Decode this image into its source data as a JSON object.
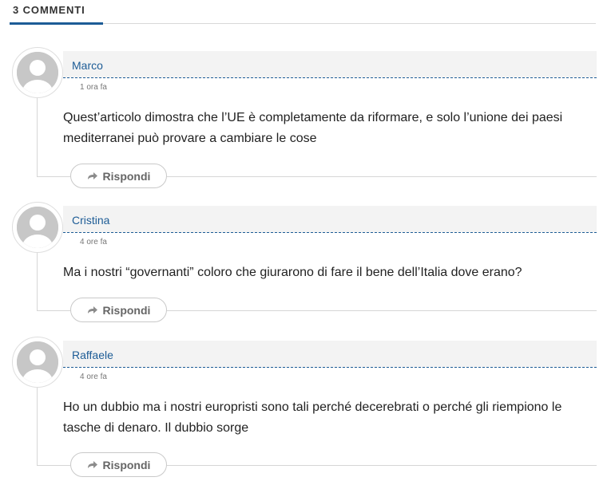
{
  "header": {
    "title": "3 COMMENTI"
  },
  "comments": [
    {
      "author": "Marco",
      "time": "1 ora fa",
      "text_lines": [
        "Quest’articolo dimostra che l’UE è completamente da riformare, e solo l’unione dei paesi",
        "mediterranei può provare a cambiare le cose"
      ],
      "reply_label": "Rispondi"
    },
    {
      "author": "Cristina",
      "time": "4 ore fa",
      "text_lines": [
        "Ma i nostri “governanti” coloro che giurarono di fare il bene dell’Italia dove erano?"
      ],
      "reply_label": "Rispondi"
    },
    {
      "author": "Raffaele",
      "time": "4 ore fa",
      "text_lines": [
        "Ho un dubbio ma i nostri europristi sono tali perché decerebrati o perché gli riempiono le",
        "tasche di denaro. Il dubbio sorge"
      ],
      "reply_label": "Rispondi"
    }
  ],
  "colors": {
    "accent": "#1d5c96",
    "meta_bg": "#f3f3f3",
    "reply_text": "#666666"
  },
  "icons": {
    "avatar": "user-silhouette-icon",
    "reply": "reply-arrow-icon"
  }
}
